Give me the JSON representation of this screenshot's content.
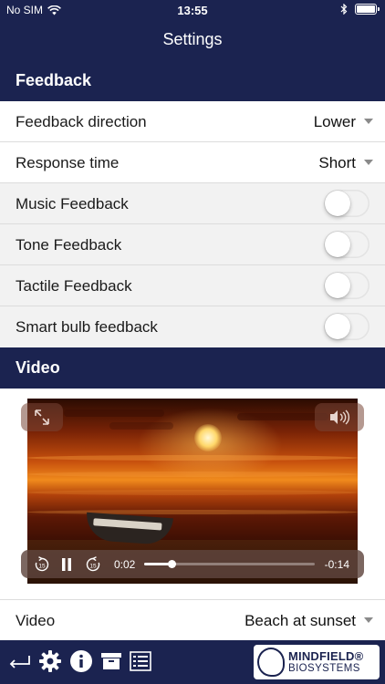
{
  "status_bar": {
    "carrier": "No SIM",
    "time": "13:55"
  },
  "nav": {
    "title": "Settings"
  },
  "sections": {
    "feedback": "Feedback",
    "video": "Video"
  },
  "settings": {
    "feedback_direction": {
      "label": "Feedback direction",
      "value": "Lower"
    },
    "response_time": {
      "label": "Response time",
      "value": "Short"
    },
    "music_feedback": {
      "label": "Music Feedback",
      "on": false
    },
    "tone_feedback": {
      "label": "Tone Feedback",
      "on": false
    },
    "tactile_feedback": {
      "label": "Tactile Feedback",
      "on": false
    },
    "smart_bulb_feedback": {
      "label": "Smart bulb feedback",
      "on": false
    }
  },
  "player": {
    "current_time": "0:02",
    "remaining_time": "-0:14",
    "progress": 0.16,
    "skip_back": "15",
    "skip_forward": "15"
  },
  "video_select": {
    "label": "Video",
    "value": "Beach at sunset"
  },
  "boat_text": "RI-1",
  "logo": {
    "line1": "MINDFIELD®",
    "line2": "BIOSYSTEMS"
  },
  "colors": {
    "navy": "#1b2350",
    "row_grey": "#f2f2f2"
  },
  "icons": [
    "wifi-icon",
    "bluetooth-icon",
    "battery-icon",
    "fullscreen-icon",
    "volume-icon",
    "skip-back-15-icon",
    "pause-icon",
    "skip-forward-15-icon",
    "back-arrow-icon",
    "gear-icon",
    "info-icon",
    "archive-icon",
    "list-icon"
  ]
}
